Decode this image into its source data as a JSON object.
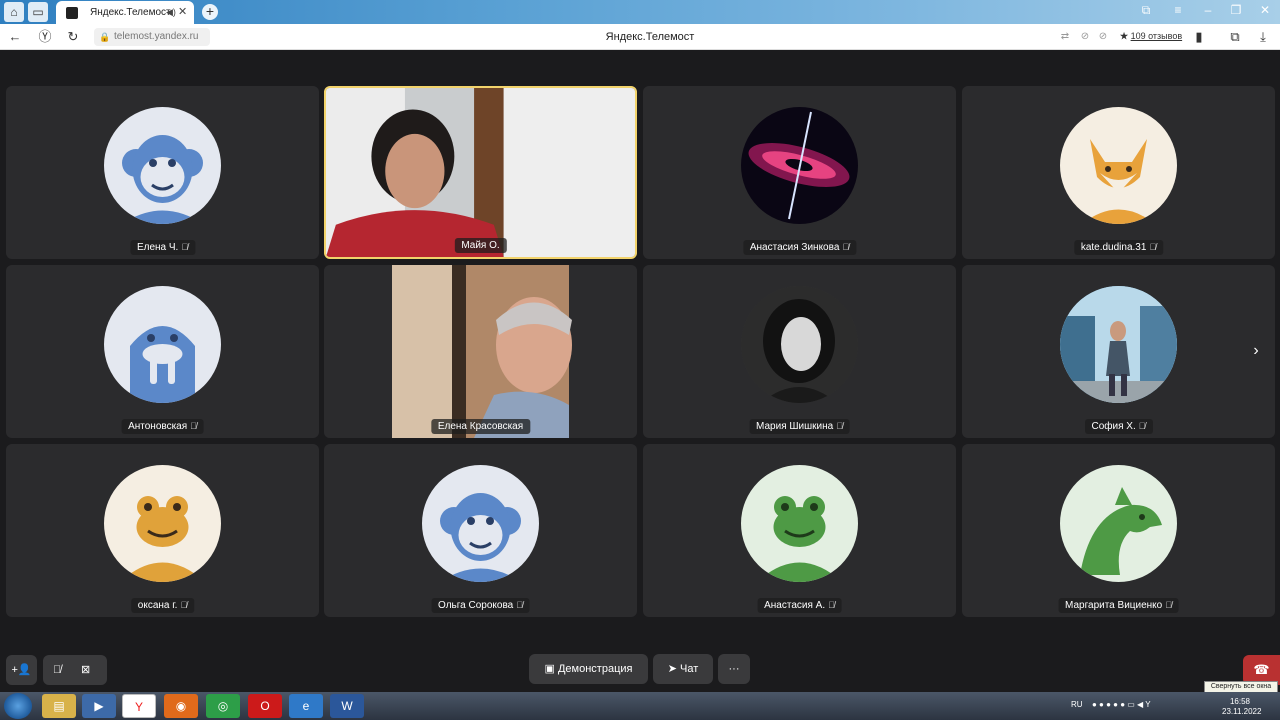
{
  "browser": {
    "tab_title": "Яндекс.Телемост",
    "url": "telemost.yandex.ru",
    "page_title": "Яндекс.Телемост",
    "reviews_star": "★",
    "reviews_label": "109 отзывов",
    "sound_icon": "◀)",
    "close_tab": "✕",
    "new_tab": "+"
  },
  "participants": [
    {
      "name": "Елена Ч.",
      "avatar": "monkey",
      "muted": true
    },
    {
      "name": "Майя О.",
      "avatar": "video-woman",
      "muted": false,
      "active": true
    },
    {
      "name": "Анастасия Зинкова",
      "avatar": "galaxy-photo",
      "muted": true
    },
    {
      "name": "kate.dudina.31",
      "avatar": "fox",
      "muted": true
    },
    {
      "name": "Антоновская",
      "avatar": "walrus",
      "muted": true
    },
    {
      "name": "Елена Красовская",
      "avatar": "video-elder",
      "muted": false
    },
    {
      "name": "Мария Шишкина",
      "avatar": "bw-portrait",
      "muted": true
    },
    {
      "name": "София Х.",
      "avatar": "city-photo",
      "muted": true
    },
    {
      "name": "оксана г.",
      "avatar": "frog-orange",
      "muted": true
    },
    {
      "name": "Ольга Сорокова",
      "avatar": "monkey",
      "muted": true
    },
    {
      "name": "Анастасия А.",
      "avatar": "frog-green",
      "muted": true
    },
    {
      "name": "Маргарита Вициенко",
      "avatar": "dolphin",
      "muted": true
    }
  ],
  "controls": {
    "demo_label": "Демонстрация",
    "chat_label": "Чат",
    "more_label": "···",
    "tooltip": "Свернуть все окна"
  },
  "taskbar": {
    "lang": "RU",
    "time": "16:58",
    "date": "23.11.2022"
  }
}
